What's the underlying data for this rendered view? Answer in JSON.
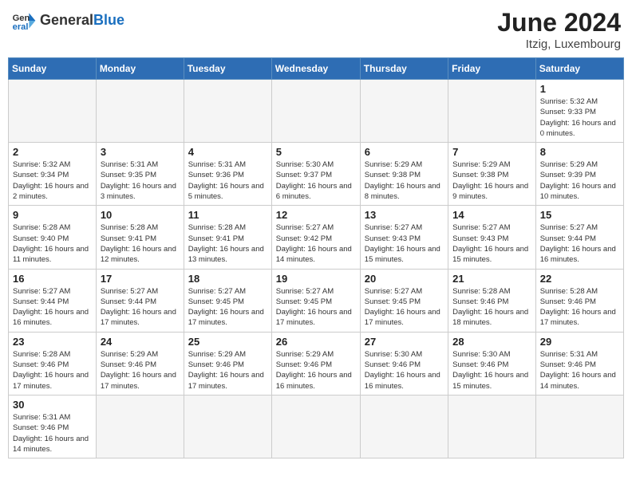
{
  "header": {
    "logo_general": "General",
    "logo_blue": "Blue",
    "month_year": "June 2024",
    "location": "Itzig, Luxembourg"
  },
  "days_of_week": [
    "Sunday",
    "Monday",
    "Tuesday",
    "Wednesday",
    "Thursday",
    "Friday",
    "Saturday"
  ],
  "weeks": [
    [
      {
        "day": "",
        "info": ""
      },
      {
        "day": "",
        "info": ""
      },
      {
        "day": "",
        "info": ""
      },
      {
        "day": "",
        "info": ""
      },
      {
        "day": "",
        "info": ""
      },
      {
        "day": "",
        "info": ""
      },
      {
        "day": "1",
        "info": "Sunrise: 5:32 AM\nSunset: 9:33 PM\nDaylight: 16 hours\nand 0 minutes."
      }
    ],
    [
      {
        "day": "2",
        "info": "Sunrise: 5:32 AM\nSunset: 9:34 PM\nDaylight: 16 hours\nand 2 minutes."
      },
      {
        "day": "3",
        "info": "Sunrise: 5:31 AM\nSunset: 9:35 PM\nDaylight: 16 hours\nand 3 minutes."
      },
      {
        "day": "4",
        "info": "Sunrise: 5:31 AM\nSunset: 9:36 PM\nDaylight: 16 hours\nand 5 minutes."
      },
      {
        "day": "5",
        "info": "Sunrise: 5:30 AM\nSunset: 9:37 PM\nDaylight: 16 hours\nand 6 minutes."
      },
      {
        "day": "6",
        "info": "Sunrise: 5:29 AM\nSunset: 9:38 PM\nDaylight: 16 hours\nand 8 minutes."
      },
      {
        "day": "7",
        "info": "Sunrise: 5:29 AM\nSunset: 9:38 PM\nDaylight: 16 hours\nand 9 minutes."
      },
      {
        "day": "8",
        "info": "Sunrise: 5:29 AM\nSunset: 9:39 PM\nDaylight: 16 hours\nand 10 minutes."
      }
    ],
    [
      {
        "day": "9",
        "info": "Sunrise: 5:28 AM\nSunset: 9:40 PM\nDaylight: 16 hours\nand 11 minutes."
      },
      {
        "day": "10",
        "info": "Sunrise: 5:28 AM\nSunset: 9:41 PM\nDaylight: 16 hours\nand 12 minutes."
      },
      {
        "day": "11",
        "info": "Sunrise: 5:28 AM\nSunset: 9:41 PM\nDaylight: 16 hours\nand 13 minutes."
      },
      {
        "day": "12",
        "info": "Sunrise: 5:27 AM\nSunset: 9:42 PM\nDaylight: 16 hours\nand 14 minutes."
      },
      {
        "day": "13",
        "info": "Sunrise: 5:27 AM\nSunset: 9:43 PM\nDaylight: 16 hours\nand 15 minutes."
      },
      {
        "day": "14",
        "info": "Sunrise: 5:27 AM\nSunset: 9:43 PM\nDaylight: 16 hours\nand 15 minutes."
      },
      {
        "day": "15",
        "info": "Sunrise: 5:27 AM\nSunset: 9:44 PM\nDaylight: 16 hours\nand 16 minutes."
      }
    ],
    [
      {
        "day": "16",
        "info": "Sunrise: 5:27 AM\nSunset: 9:44 PM\nDaylight: 16 hours\nand 16 minutes."
      },
      {
        "day": "17",
        "info": "Sunrise: 5:27 AM\nSunset: 9:44 PM\nDaylight: 16 hours\nand 17 minutes."
      },
      {
        "day": "18",
        "info": "Sunrise: 5:27 AM\nSunset: 9:45 PM\nDaylight: 16 hours\nand 17 minutes."
      },
      {
        "day": "19",
        "info": "Sunrise: 5:27 AM\nSunset: 9:45 PM\nDaylight: 16 hours\nand 17 minutes."
      },
      {
        "day": "20",
        "info": "Sunrise: 5:27 AM\nSunset: 9:45 PM\nDaylight: 16 hours\nand 17 minutes."
      },
      {
        "day": "21",
        "info": "Sunrise: 5:28 AM\nSunset: 9:46 PM\nDaylight: 16 hours\nand 18 minutes."
      },
      {
        "day": "22",
        "info": "Sunrise: 5:28 AM\nSunset: 9:46 PM\nDaylight: 16 hours\nand 17 minutes."
      }
    ],
    [
      {
        "day": "23",
        "info": "Sunrise: 5:28 AM\nSunset: 9:46 PM\nDaylight: 16 hours\nand 17 minutes."
      },
      {
        "day": "24",
        "info": "Sunrise: 5:29 AM\nSunset: 9:46 PM\nDaylight: 16 hours\nand 17 minutes."
      },
      {
        "day": "25",
        "info": "Sunrise: 5:29 AM\nSunset: 9:46 PM\nDaylight: 16 hours\nand 17 minutes."
      },
      {
        "day": "26",
        "info": "Sunrise: 5:29 AM\nSunset: 9:46 PM\nDaylight: 16 hours\nand 16 minutes."
      },
      {
        "day": "27",
        "info": "Sunrise: 5:30 AM\nSunset: 9:46 PM\nDaylight: 16 hours\nand 16 minutes."
      },
      {
        "day": "28",
        "info": "Sunrise: 5:30 AM\nSunset: 9:46 PM\nDaylight: 16 hours\nand 15 minutes."
      },
      {
        "day": "29",
        "info": "Sunrise: 5:31 AM\nSunset: 9:46 PM\nDaylight: 16 hours\nand 14 minutes."
      }
    ],
    [
      {
        "day": "30",
        "info": "Sunrise: 5:31 AM\nSunset: 9:46 PM\nDaylight: 16 hours\nand 14 minutes."
      },
      {
        "day": "",
        "info": ""
      },
      {
        "day": "",
        "info": ""
      },
      {
        "day": "",
        "info": ""
      },
      {
        "day": "",
        "info": ""
      },
      {
        "day": "",
        "info": ""
      },
      {
        "day": "",
        "info": ""
      }
    ]
  ]
}
